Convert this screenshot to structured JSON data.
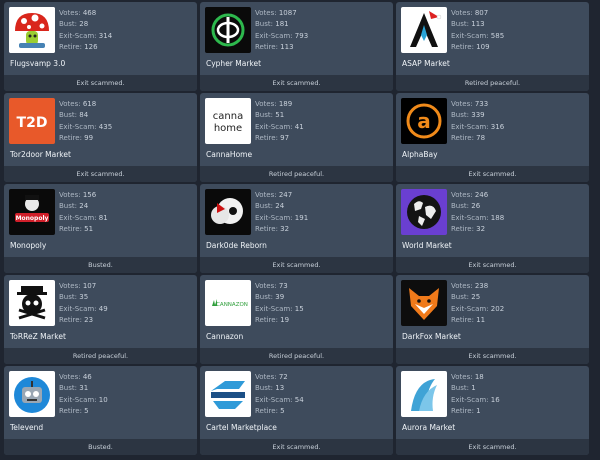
{
  "labels": {
    "votes": "Votes:",
    "bust": "Bust:",
    "exit": "Exit-Scam:",
    "retire": "Retire:"
  },
  "markets": [
    {
      "name": "Flugsvamp 3.0",
      "votes": "468",
      "bust": "28",
      "exit": "314",
      "retire": "126",
      "status": "Exit scammed.",
      "logo": "mushroom-logo-icon"
    },
    {
      "name": "Cypher Market",
      "votes": "1087",
      "bust": "181",
      "exit": "793",
      "retire": "113",
      "status": "Exit scammed.",
      "logo": "phi-logo-icon"
    },
    {
      "name": "ASAP Market",
      "votes": "807",
      "bust": "113",
      "exit": "585",
      "retire": "109",
      "status": "Retired peaceful.",
      "logo": "rocket-logo-icon"
    },
    {
      "name": "Tor2door Market",
      "votes": "618",
      "bust": "84",
      "exit": "435",
      "retire": "99",
      "status": "Exit scammed.",
      "logo": "t2d-logo-icon",
      "logo_text": "T2D"
    },
    {
      "name": "CannaHome",
      "votes": "189",
      "bust": "51",
      "exit": "41",
      "retire": "97",
      "status": "Retired peaceful.",
      "logo": "cannahome-logo-icon",
      "logo_text": "canna",
      "logo_text2": "home"
    },
    {
      "name": "AlphaBay",
      "votes": "733",
      "bust": "339",
      "exit": "316",
      "retire": "78",
      "status": "Exit scammed.",
      "logo": "alpha-logo-icon",
      "logo_text": "a"
    },
    {
      "name": "Monopoly",
      "votes": "156",
      "bust": "24",
      "exit": "81",
      "retire": "51",
      "status": "Busted.",
      "logo": "monopoly-logo-icon",
      "logo_text": "Monopoly"
    },
    {
      "name": "Dark0de Reborn",
      "votes": "247",
      "bust": "24",
      "exit": "191",
      "retire": "32",
      "status": "Exit scammed.",
      "logo": "dark0de-logo-icon"
    },
    {
      "name": "World Market",
      "votes": "246",
      "bust": "26",
      "exit": "188",
      "retire": "32",
      "status": "Exit scammed.",
      "logo": "globe-logo-icon"
    },
    {
      "name": "ToRReZ Market",
      "votes": "107",
      "bust": "35",
      "exit": "49",
      "retire": "23",
      "status": "Retired peaceful.",
      "logo": "skull-logo-icon"
    },
    {
      "name": "Cannazon",
      "votes": "73",
      "bust": "39",
      "exit": "15",
      "retire": "19",
      "status": "Retired peaceful.",
      "logo": "cannazon-logo-icon",
      "logo_text": "CANNAZON"
    },
    {
      "name": "DarkFox Market",
      "votes": "238",
      "bust": "25",
      "exit": "202",
      "retire": "11",
      "status": "Exit scammed.",
      "logo": "fox-logo-icon"
    },
    {
      "name": "Televend",
      "votes": "46",
      "bust": "31",
      "exit": "10",
      "retire": "5",
      "status": "Busted.",
      "logo": "robot-logo-icon"
    },
    {
      "name": "Cartel Marketplace",
      "votes": "72",
      "bust": "13",
      "exit": "54",
      "retire": "5",
      "status": "Exit scammed.",
      "logo": "cartel-logo-icon"
    },
    {
      "name": "Aurora Market",
      "votes": "18",
      "bust": "1",
      "exit": "16",
      "retire": "1",
      "status": "Exit scammed.",
      "logo": "aurora-logo-icon"
    }
  ],
  "colors": {
    "card": "#3e4b5c",
    "status_bar": "#2c3542",
    "page": "#1f2530"
  }
}
